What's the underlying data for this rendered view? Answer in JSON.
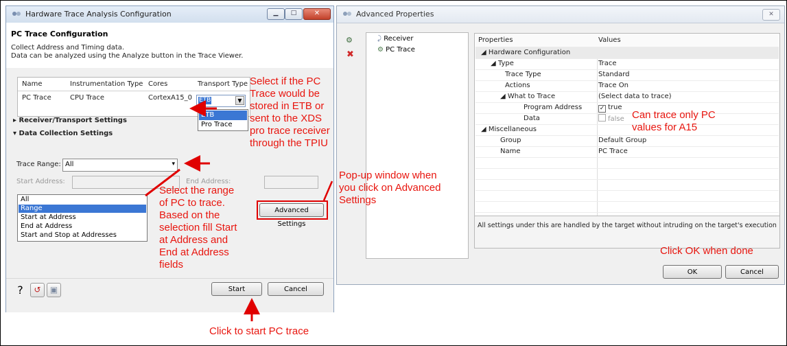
{
  "left_dialog": {
    "window_title": "Hardware Trace Analysis Configuration",
    "header_title": "PC Trace Configuration",
    "header_desc_1": "Collect Address and Timing data.",
    "header_desc_2": "Data can be analyzed using the Analyze button in the Trace Viewer.",
    "table": {
      "headers": [
        "Name",
        "Instrumentation Type",
        "Cores",
        "Transport Type"
      ],
      "row": [
        "PC Trace",
        "CPU Trace",
        "CortexA15_0"
      ],
      "transport_value": "ETB"
    },
    "transport_options": [
      "ETB",
      "Pro Trace"
    ],
    "sections": [
      "Receiver/Transport Settings",
      "Data Collection Settings"
    ],
    "trace_range_label": "Trace Range:",
    "trace_range_value": "All",
    "start_address_label": "Start Address:",
    "end_address_label": "End Address:",
    "range_options": [
      "All",
      "Range",
      "Start at Address",
      "End at Address",
      "Start and Stop at Addresses"
    ],
    "advanced_button": "Advanced Settings",
    "start_button": "Start",
    "cancel_button": "Cancel"
  },
  "right_dialog": {
    "window_title": "Advanced Properties",
    "tree": [
      "Receiver",
      "PC Trace"
    ],
    "col_properties": "Properties",
    "col_values": "Values",
    "rows": [
      {
        "p": "Hardware Configuration",
        "v": ""
      },
      {
        "p": "Type",
        "v": "Trace"
      },
      {
        "p": "Trace Type",
        "v": "Standard"
      },
      {
        "p": "Actions",
        "v": "Trace On"
      },
      {
        "p": "What to Trace",
        "v": "(Select data to trace)"
      },
      {
        "p": "Program Address",
        "v": "true"
      },
      {
        "p": "Data",
        "v": "false"
      },
      {
        "p": "Miscellaneous",
        "v": ""
      },
      {
        "p": "Group",
        "v": "Default Group"
      },
      {
        "p": "Name",
        "v": "PC Trace"
      }
    ],
    "description": "All settings under this are handled by the target without intruding on the target's execution",
    "ok_button": "OK",
    "cancel_button": "Cancel"
  },
  "annotations": {
    "transport": [
      "Select if the PC",
      "Trace would be",
      "stored in ETB or",
      "sent to the XDS",
      "pro trace receiver",
      "through the TPIU"
    ],
    "popup": [
      "Pop-up window when",
      "you click on Advanced",
      "Settings"
    ],
    "range": [
      "Select the range",
      "of PC to trace.",
      "Based on the",
      "selection fill Start",
      "at Address and",
      "End at Address",
      "fields"
    ],
    "pc_only": [
      "Can trace only PC",
      "values for A15"
    ],
    "ok": "Click OK when done",
    "start": "Click to start PC trace"
  },
  "colors": {
    "annotation": "#e8150e",
    "selection": "#3b77d4"
  }
}
